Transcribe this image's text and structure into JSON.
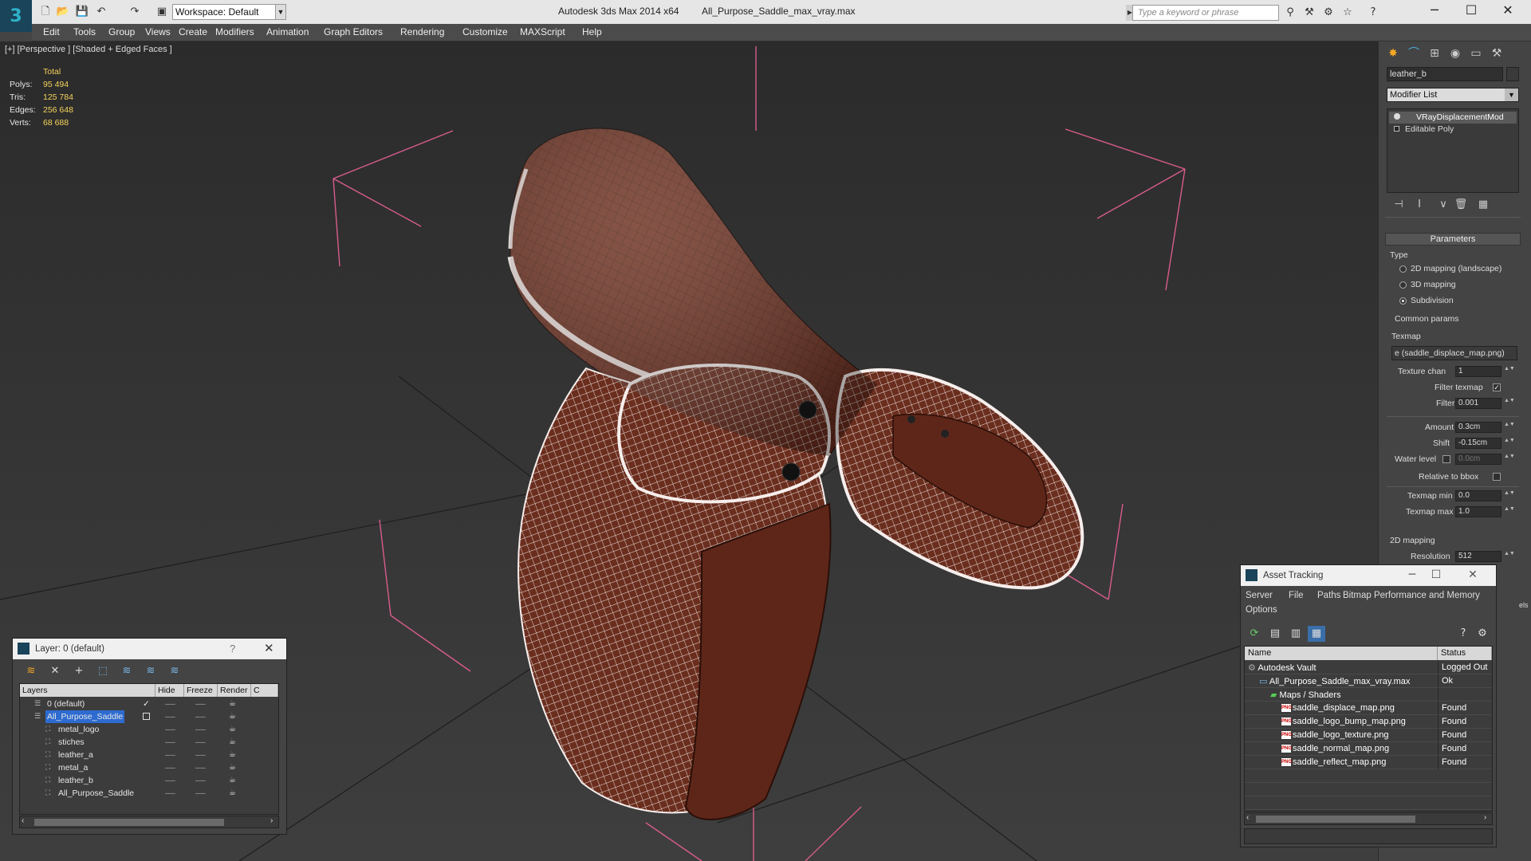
{
  "app": {
    "title": "Autodesk 3ds Max  2014 x64",
    "file": "All_Purpose_Saddle_max_vray.max",
    "workspace": "Workspace: Default",
    "search_placeholder": "Type a keyword or phrase"
  },
  "menus": [
    "Edit",
    "Tools",
    "Group",
    "Views",
    "Create",
    "Modifiers",
    "Animation",
    "Graph Editors",
    "Rendering",
    "Customize",
    "MAXScript",
    "Help"
  ],
  "viewport": {
    "label": "[+] [Perspective ] [Shaded + Edged Faces ]",
    "stats": {
      "header": "Total",
      "rows": [
        {
          "label": "Polys:",
          "value": "95 494"
        },
        {
          "label": "Tris:",
          "value": "125 784"
        },
        {
          "label": "Edges:",
          "value": "256 648"
        },
        {
          "label": "Verts:",
          "value": "68 688"
        }
      ]
    },
    "colors": {
      "mesh": "#6b2e1e",
      "wire": "#ffffff",
      "bbox": "#e05a8a"
    }
  },
  "command_panel": {
    "object_name": "leather_b",
    "modifier_list": "Modifier List",
    "stack": [
      "VRayDisplacementMod",
      "Editable Poly"
    ],
    "rollout": "Parameters",
    "type_label": "Type",
    "types": [
      "2D mapping (landscape)",
      "3D mapping",
      "Subdivision"
    ],
    "selected_type": "Subdivision",
    "common_params": "Common params",
    "texmap_label": "Texmap",
    "texmap_value": "e (saddle_displace_map.png)",
    "texture_chan_label": "Texture chan",
    "texture_chan": "1",
    "filter_texmap_label": "Filter texmap",
    "filter_blur_label": "Filter blur",
    "filter_blur": "0.001",
    "amount_label": "Amount",
    "amount": "0.3cm",
    "shift_label": "Shift",
    "shift": "-0.15cm",
    "water_level_label": "Water level",
    "water_level": "0.0cm",
    "relative_label": "Relative to bbox",
    "texmap_min_label": "Texmap min",
    "texmap_min": "0.0",
    "texmap_max_label": "Texmap max",
    "texmap_max": "1.0",
    "mapping_2d_label": "2D mapping",
    "resolution_label": "Resolution",
    "resolution": "512",
    "partial_right": "els"
  },
  "layer_dialog": {
    "title": "Layer: 0 (default)",
    "help": "?",
    "columns": [
      "Layers",
      "Hide",
      "Freeze",
      "Render",
      "C"
    ],
    "rows": [
      {
        "name": "0 (default)",
        "indent": 1
      },
      {
        "name": "All_Purpose_Saddle",
        "indent": 1,
        "selected": true
      },
      {
        "name": "metal_logo",
        "indent": 2
      },
      {
        "name": "stiches",
        "indent": 2
      },
      {
        "name": "leather_a",
        "indent": 2
      },
      {
        "name": "metal_a",
        "indent": 2
      },
      {
        "name": "leather_b",
        "indent": 2
      },
      {
        "name": "All_Purpose_Saddle",
        "indent": 2
      }
    ]
  },
  "asset_dialog": {
    "title": "Asset Tracking",
    "menus": [
      "Server",
      "File",
      "Paths",
      "Bitmap Performance and Memory",
      "Options"
    ],
    "columns": [
      "Name",
      "Status"
    ],
    "rows": [
      {
        "name": "Autodesk Vault",
        "status": "Logged Out",
        "indent": 0
      },
      {
        "name": "All_Purpose_Saddle_max_vray.max",
        "status": "Ok",
        "indent": 1
      },
      {
        "name": "Maps / Shaders",
        "status": "",
        "indent": 2
      },
      {
        "name": "saddle_displace_map.png",
        "status": "Found",
        "indent": 3
      },
      {
        "name": "saddle_logo_bump_map.png",
        "status": "Found",
        "indent": 3
      },
      {
        "name": "saddle_logo_texture.png",
        "status": "Found",
        "indent": 3
      },
      {
        "name": "saddle_normal_map.png",
        "status": "Found",
        "indent": 3
      },
      {
        "name": "saddle_reflect_map.png",
        "status": "Found",
        "indent": 3
      }
    ]
  }
}
